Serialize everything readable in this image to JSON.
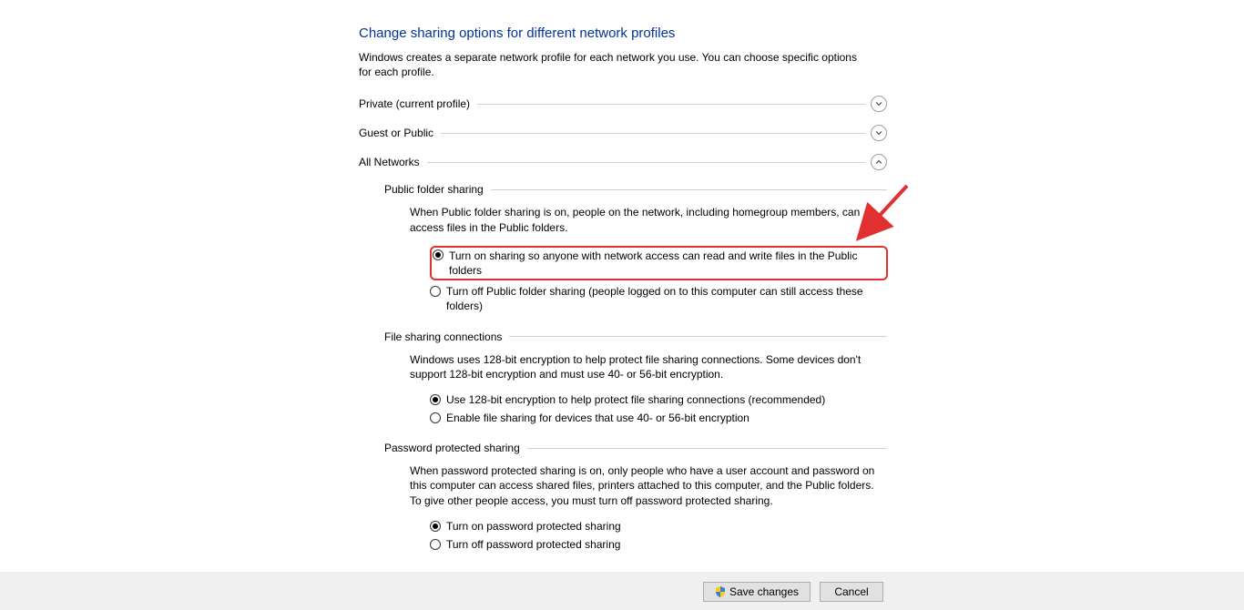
{
  "page": {
    "title": "Change sharing options for different network profiles",
    "subtitle": "Windows creates a separate network profile for each network you use. You can choose specific options for each profile."
  },
  "profiles": {
    "private": {
      "label": "Private (current profile)"
    },
    "guest": {
      "label": "Guest or Public"
    },
    "all": {
      "label": "All Networks"
    }
  },
  "public_folder": {
    "title": "Public folder sharing",
    "desc": "When Public folder sharing is on, people on the network, including homegroup members, can access files in the Public folders.",
    "opt_on": "Turn on sharing so anyone with network access can read and write files in the Public folders",
    "opt_off": "Turn off Public folder sharing (people logged on to this computer can still access these folders)"
  },
  "file_sharing": {
    "title": "File sharing connections",
    "desc": "Windows uses 128-bit encryption to help protect file sharing connections. Some devices don't support 128-bit encryption and must use 40- or 56-bit encryption.",
    "opt_128": "Use 128-bit encryption to help protect file sharing connections (recommended)",
    "opt_40": "Enable file sharing for devices that use 40- or 56-bit encryption"
  },
  "password": {
    "title": "Password protected sharing",
    "desc": "When password protected sharing is on, only people who have a user account and password on this computer can access shared files, printers attached to this computer, and the Public folders. To give other people access, you must turn off password protected sharing.",
    "opt_on": "Turn on password protected sharing",
    "opt_off": "Turn off password protected sharing"
  },
  "buttons": {
    "save": "Save changes",
    "cancel": "Cancel"
  }
}
